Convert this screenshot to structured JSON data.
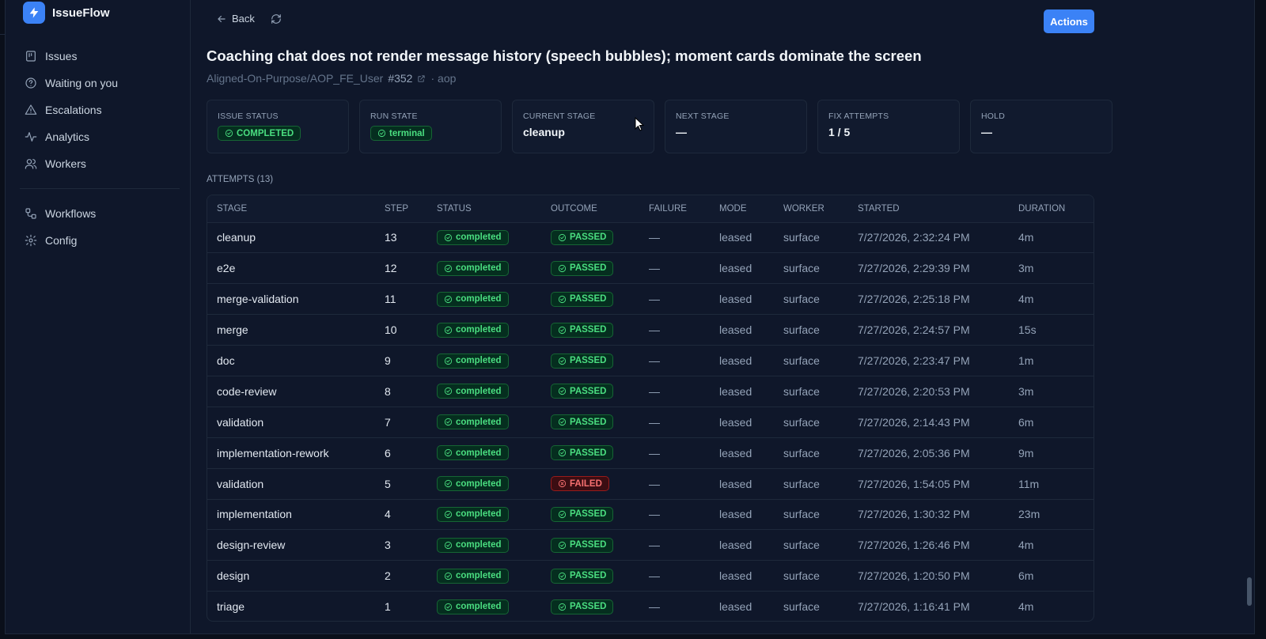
{
  "app": {
    "name": "IssueFlow"
  },
  "sidebar": {
    "items": [
      {
        "label": "Issues",
        "icon": "issues-icon"
      },
      {
        "label": "Waiting on you",
        "icon": "help-circle-icon"
      },
      {
        "label": "Escalations",
        "icon": "alert-triangle-icon"
      },
      {
        "label": "Analytics",
        "icon": "activity-icon"
      },
      {
        "label": "Workers",
        "icon": "users-icon"
      }
    ],
    "secondary": [
      {
        "label": "Workflows",
        "icon": "workflow-icon"
      },
      {
        "label": "Config",
        "icon": "gear-icon"
      }
    ]
  },
  "toolbar": {
    "back_label": "Back",
    "actions_label": "Actions"
  },
  "issue": {
    "title": "Coaching chat does not render message history (speech bubbles); moment cards dominate the screen",
    "repo": "Aligned-On-Purpose/AOP_FE_User",
    "number": "#352",
    "project": "· aop"
  },
  "cards": [
    {
      "label": "Issue Status",
      "badge": "COMPLETED"
    },
    {
      "label": "Run State",
      "badge": "terminal"
    },
    {
      "label": "Current Stage",
      "value": "cleanup"
    },
    {
      "label": "Next Stage",
      "value": "—"
    },
    {
      "label": "Fix Attempts",
      "value": "1 / 5"
    },
    {
      "label": "Hold",
      "value": "—"
    }
  ],
  "attempts": {
    "label": "ATTEMPTS (13)",
    "columns": [
      "Stage",
      "Step",
      "Status",
      "Outcome",
      "Failure",
      "Mode",
      "Worker",
      "Started",
      "Duration"
    ],
    "rows": [
      {
        "stage": "cleanup",
        "step": "13",
        "status": "completed",
        "outcome": "PASSED",
        "failure": "—",
        "mode": "leased",
        "worker": "surface",
        "started": "7/27/2026, 2:32:24 PM",
        "duration": "4m"
      },
      {
        "stage": "e2e",
        "step": "12",
        "status": "completed",
        "outcome": "PASSED",
        "failure": "—",
        "mode": "leased",
        "worker": "surface",
        "started": "7/27/2026, 2:29:39 PM",
        "duration": "3m"
      },
      {
        "stage": "merge-validation",
        "step": "11",
        "status": "completed",
        "outcome": "PASSED",
        "failure": "—",
        "mode": "leased",
        "worker": "surface",
        "started": "7/27/2026, 2:25:18 PM",
        "duration": "4m"
      },
      {
        "stage": "merge",
        "step": "10",
        "status": "completed",
        "outcome": "PASSED",
        "failure": "—",
        "mode": "leased",
        "worker": "surface",
        "started": "7/27/2026, 2:24:57 PM",
        "duration": "15s"
      },
      {
        "stage": "doc",
        "step": "9",
        "status": "completed",
        "outcome": "PASSED",
        "failure": "—",
        "mode": "leased",
        "worker": "surface",
        "started": "7/27/2026, 2:23:47 PM",
        "duration": "1m"
      },
      {
        "stage": "code-review",
        "step": "8",
        "status": "completed",
        "outcome": "PASSED",
        "failure": "—",
        "mode": "leased",
        "worker": "surface",
        "started": "7/27/2026, 2:20:53 PM",
        "duration": "3m"
      },
      {
        "stage": "validation",
        "step": "7",
        "status": "completed",
        "outcome": "PASSED",
        "failure": "—",
        "mode": "leased",
        "worker": "surface",
        "started": "7/27/2026, 2:14:43 PM",
        "duration": "6m"
      },
      {
        "stage": "implementation-rework",
        "step": "6",
        "status": "completed",
        "outcome": "PASSED",
        "failure": "—",
        "mode": "leased",
        "worker": "surface",
        "started": "7/27/2026, 2:05:36 PM",
        "duration": "9m"
      },
      {
        "stage": "validation",
        "step": "5",
        "status": "completed",
        "outcome": "FAILED",
        "failure": "—",
        "mode": "leased",
        "worker": "surface",
        "started": "7/27/2026, 1:54:05 PM",
        "duration": "11m"
      },
      {
        "stage": "implementation",
        "step": "4",
        "status": "completed",
        "outcome": "PASSED",
        "failure": "—",
        "mode": "leased",
        "worker": "surface",
        "started": "7/27/2026, 1:30:32 PM",
        "duration": "23m"
      },
      {
        "stage": "design-review",
        "step": "3",
        "status": "completed",
        "outcome": "PASSED",
        "failure": "—",
        "mode": "leased",
        "worker": "surface",
        "started": "7/27/2026, 1:26:46 PM",
        "duration": "4m"
      },
      {
        "stage": "design",
        "step": "2",
        "status": "completed",
        "outcome": "PASSED",
        "failure": "—",
        "mode": "leased",
        "worker": "surface",
        "started": "7/27/2026, 1:20:50 PM",
        "duration": "6m"
      },
      {
        "stage": "triage",
        "step": "1",
        "status": "completed",
        "outcome": "PASSED",
        "failure": "—",
        "mode": "leased",
        "worker": "surface",
        "started": "7/27/2026, 1:16:41 PM",
        "duration": "4m"
      }
    ]
  },
  "colors": {
    "accent": "#3b82f6",
    "success": "#4ade80",
    "danger": "#f87171",
    "background": "#0f172a"
  }
}
